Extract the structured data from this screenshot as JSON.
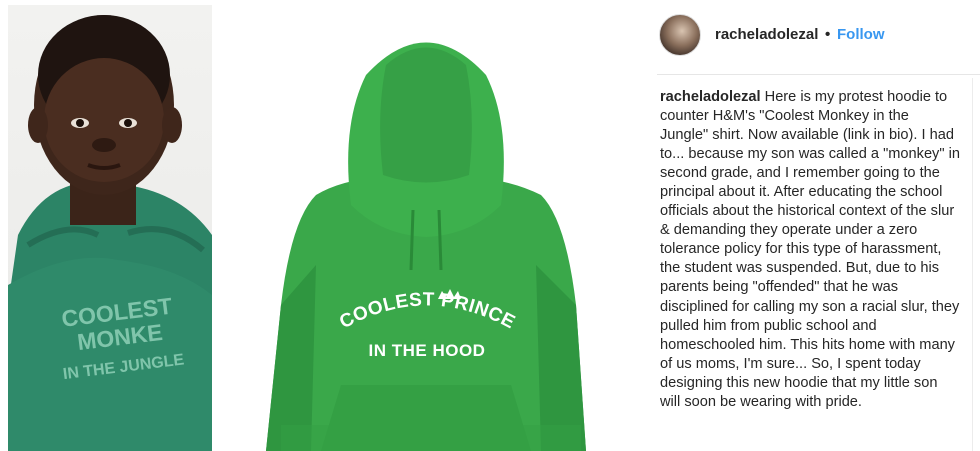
{
  "post": {
    "username": "racheladolezal",
    "separator": "•",
    "follow_label": "Follow",
    "caption_user": "racheladolezal",
    "caption_text": "Here is my protest hoodie to counter H&M's \"Coolest Monkey in the Jungle\" shirt. Now available (link in bio). I had to... because my son was called a \"monkey\" in second grade, and I remember going to the principal about it. After educating the school officials about the historical context of the slur & demanding they operate under a zero tolerance policy for this type of harassment, the student was suspended. But, due to his parents being \"offended\" that he was disciplined for calling my son a racial slur, they pulled him from public school and homeschooled him. This hits home with many of us moms, I'm sure... So, I spent today designing this new hoodie that my little son will soon be wearing with pride."
  },
  "images": {
    "left_print_line1": "COOLEST MONKE",
    "left_print_line2": "IN THE JUNGLE",
    "mid_print_line1": "COOLEST PRINCE",
    "mid_print_line2": "IN THE HOOD"
  },
  "colors": {
    "hm_green": "#2f8a6a",
    "hoodie_green": "#3aa84a",
    "follow_blue": "#3897f0"
  }
}
